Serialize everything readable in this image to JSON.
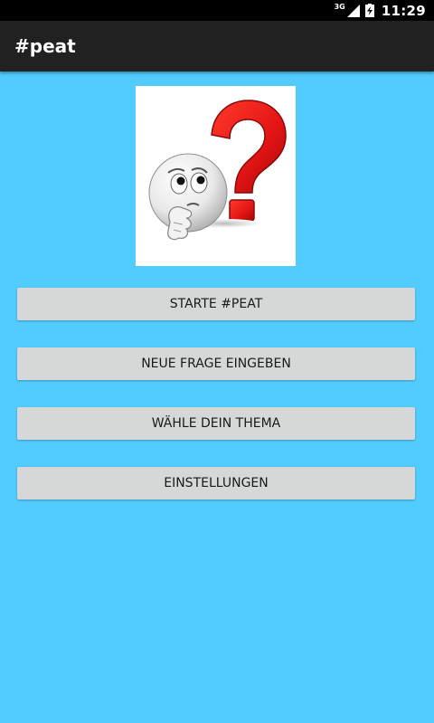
{
  "status_bar": {
    "network": "3G",
    "time": "11:29",
    "signal_icon": "cell-signal-icon",
    "battery_icon": "battery-charging-icon"
  },
  "app_bar": {
    "title": "#peat"
  },
  "logo": {
    "icon": "thinking-smiley-question-mark-icon"
  },
  "buttons": [
    {
      "label": "STARTE #PEAT"
    },
    {
      "label": "NEUE FRAGE EINGEBEN"
    },
    {
      "label": "WÄHLE DEIN THEMA"
    },
    {
      "label": "EINSTELLUNGEN"
    }
  ],
  "colors": {
    "background": "#52CCFF",
    "app_bar": "#212121",
    "status_bar": "#000000",
    "button": "#D6D7D7",
    "question_mark": "#E01010"
  }
}
